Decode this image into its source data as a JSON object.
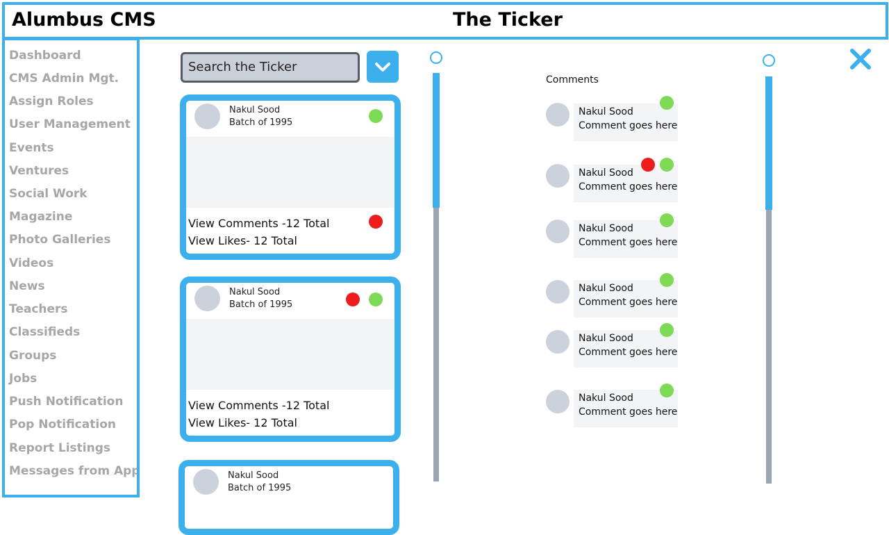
{
  "header": {
    "app_title": "Alumbus CMS",
    "page_title": "The Ticker"
  },
  "sidebar": {
    "items": [
      {
        "label": "Dashboard"
      },
      {
        "label": "CMS Admin Mgt."
      },
      {
        "label": "Assign Roles"
      },
      {
        "label": "User Management"
      },
      {
        "label": "Events"
      },
      {
        "label": "Ventures"
      },
      {
        "label": "Social Work"
      },
      {
        "label": "Magazine"
      },
      {
        "label": "Photo Galleries"
      },
      {
        "label": "Videos"
      },
      {
        "label": "News"
      },
      {
        "label": "Teachers"
      },
      {
        "label": "Classifieds"
      },
      {
        "label": "Groups"
      },
      {
        "label": "Jobs"
      },
      {
        "label": "Push Notification"
      },
      {
        "label": "Pop Notification"
      },
      {
        "label": "Report Listings"
      },
      {
        "label": "Messages from App"
      }
    ]
  },
  "search": {
    "placeholder": "Search the Ticker",
    "dropdown_icon": "chevron-down-icon"
  },
  "posts": [
    {
      "name": "Nakul Sood",
      "batch": "Batch of 1995",
      "comments_label": "View Comments -12 Total",
      "likes_label": "View Likes- 12 Total"
    },
    {
      "name": "Nakul Sood",
      "batch": "Batch of 1995",
      "comments_label": "View Comments -12 Total",
      "likes_label": "View Likes- 12 Total"
    },
    {
      "name": "Nakul Sood",
      "batch": "Batch of 1995"
    }
  ],
  "comments_panel": {
    "title": "Comments",
    "items": [
      {
        "name": "Nakul Sood",
        "text": "Comment goes here"
      },
      {
        "name": "Nakul Sood",
        "text": "Comment goes here"
      },
      {
        "name": "Nakul Sood",
        "text": "Comment goes here"
      },
      {
        "name": "Nakul Sood",
        "text": "Comment goes here"
      },
      {
        "name": "Nakul Sood",
        "text": "Comment goes here"
      },
      {
        "name": "Nakul Sood",
        "text": "Comment goes here"
      }
    ]
  },
  "close_icon": "close-icon",
  "colors": {
    "accent": "#3bb0ed",
    "approve": "#7ed957",
    "reject": "#ee1d1d",
    "muted_text": "#a6a6a6",
    "track": "#9aa6b2"
  },
  "scroll": {
    "feed_position": 0.3,
    "comments_position": 0.3
  }
}
